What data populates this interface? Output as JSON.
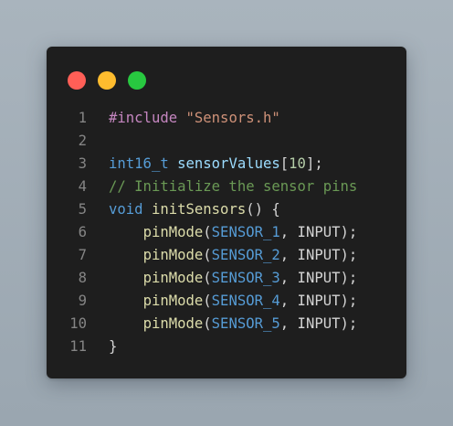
{
  "window": {
    "controls": [
      {
        "name": "close",
        "color": "#ff5f57"
      },
      {
        "name": "minimize",
        "color": "#febc2e"
      },
      {
        "name": "maximize",
        "color": "#28c840"
      }
    ]
  },
  "syntax_colors": {
    "default": "#d4d4d4",
    "line_number": "#858585",
    "directive": "#c586c0",
    "string": "#ce9178",
    "type": "#569cd6",
    "variable": "#9cdcfe",
    "number": "#b5cea8",
    "comment": "#6a9955",
    "function": "#dcdcaa",
    "constant": "#4fc1ff"
  },
  "code": {
    "lines": [
      {
        "number": "1",
        "tokens": [
          {
            "text": "#include",
            "kind": "directive"
          },
          {
            "text": " ",
            "kind": "default"
          },
          {
            "text": "\"Sensors.h\"",
            "kind": "string"
          }
        ]
      },
      {
        "number": "2",
        "tokens": []
      },
      {
        "number": "3",
        "tokens": [
          {
            "text": "int16_t",
            "kind": "type"
          },
          {
            "text": " ",
            "kind": "default"
          },
          {
            "text": "sensorValues",
            "kind": "variable"
          },
          {
            "text": "[",
            "kind": "default"
          },
          {
            "text": "10",
            "kind": "number"
          },
          {
            "text": "];",
            "kind": "default"
          }
        ]
      },
      {
        "number": "4",
        "tokens": [
          {
            "text": "// Initialize the sensor pins",
            "kind": "comment"
          }
        ]
      },
      {
        "number": "5",
        "tokens": [
          {
            "text": "void",
            "kind": "type"
          },
          {
            "text": " ",
            "kind": "default"
          },
          {
            "text": "initSensors",
            "kind": "function"
          },
          {
            "text": "() {",
            "kind": "default"
          }
        ]
      },
      {
        "number": "6",
        "tokens": [
          {
            "text": "    ",
            "kind": "default"
          },
          {
            "text": "pinMode",
            "kind": "function"
          },
          {
            "text": "(",
            "kind": "default"
          },
          {
            "text": "SENSOR_1",
            "kind": "type"
          },
          {
            "text": ", INPUT);",
            "kind": "default"
          }
        ]
      },
      {
        "number": "7",
        "tokens": [
          {
            "text": "    ",
            "kind": "default"
          },
          {
            "text": "pinMode",
            "kind": "function"
          },
          {
            "text": "(",
            "kind": "default"
          },
          {
            "text": "SENSOR_2",
            "kind": "type"
          },
          {
            "text": ", INPUT);",
            "kind": "default"
          }
        ]
      },
      {
        "number": "8",
        "tokens": [
          {
            "text": "    ",
            "kind": "default"
          },
          {
            "text": "pinMode",
            "kind": "function"
          },
          {
            "text": "(",
            "kind": "default"
          },
          {
            "text": "SENSOR_3",
            "kind": "type"
          },
          {
            "text": ", INPUT);",
            "kind": "default"
          }
        ]
      },
      {
        "number": "9",
        "tokens": [
          {
            "text": "    ",
            "kind": "default"
          },
          {
            "text": "pinMode",
            "kind": "function"
          },
          {
            "text": "(",
            "kind": "default"
          },
          {
            "text": "SENSOR_4",
            "kind": "type"
          },
          {
            "text": ", INPUT);",
            "kind": "default"
          }
        ]
      },
      {
        "number": "10",
        "tokens": [
          {
            "text": "    ",
            "kind": "default"
          },
          {
            "text": "pinMode",
            "kind": "function"
          },
          {
            "text": "(",
            "kind": "default"
          },
          {
            "text": "SENSOR_5",
            "kind": "type"
          },
          {
            "text": ", INPUT);",
            "kind": "default"
          }
        ]
      },
      {
        "number": "11",
        "tokens": [
          {
            "text": "}",
            "kind": "default"
          }
        ]
      }
    ]
  }
}
